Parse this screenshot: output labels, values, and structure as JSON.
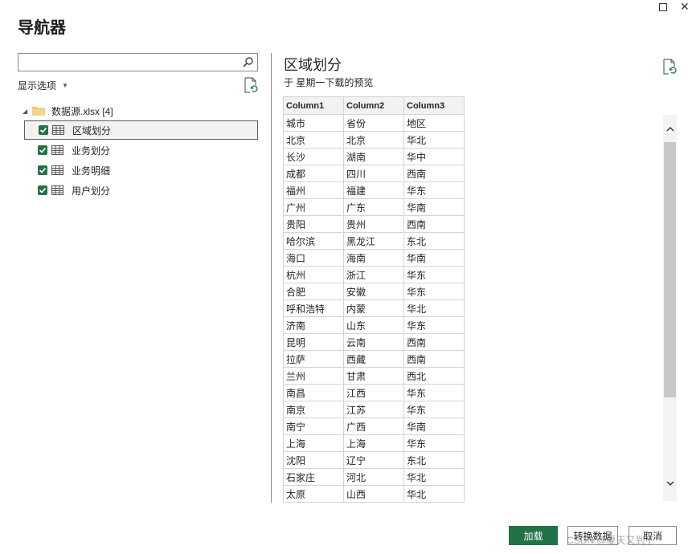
{
  "window": {
    "title": "导航器"
  },
  "navigator": {
    "search": {
      "value": "",
      "placeholder": ""
    },
    "display_options_label": "显示选项",
    "tree": {
      "root_label": "数据源.xlsx [4]",
      "items": [
        {
          "label": "区域划分",
          "checked": true,
          "selected": true
        },
        {
          "label": "业务划分",
          "checked": true,
          "selected": false
        },
        {
          "label": "业务明细",
          "checked": true,
          "selected": false
        },
        {
          "label": "用户划分",
          "checked": true,
          "selected": false
        }
      ]
    }
  },
  "preview": {
    "title": "区域划分",
    "subtitle": "于 星期一下载的预览",
    "columns": [
      "Column1",
      "Column2",
      "Column3"
    ],
    "rows": [
      [
        "城市",
        "省份",
        "地区"
      ],
      [
        "北京",
        "北京",
        "华北"
      ],
      [
        "长沙",
        "湖南",
        "华中"
      ],
      [
        "成都",
        "四川",
        "西南"
      ],
      [
        "福州",
        "福建",
        "华东"
      ],
      [
        "广州",
        "广东",
        "华南"
      ],
      [
        "贵阳",
        "贵州",
        "西南"
      ],
      [
        "哈尔滨",
        "黑龙江",
        "东北"
      ],
      [
        "海口",
        "海南",
        "华南"
      ],
      [
        "杭州",
        "浙江",
        "华东"
      ],
      [
        "合肥",
        "安徽",
        "华东"
      ],
      [
        "呼和浩特",
        "内蒙",
        "华北"
      ],
      [
        "济南",
        "山东",
        "华东"
      ],
      [
        "昆明",
        "云南",
        "西南"
      ],
      [
        "拉萨",
        "西藏",
        "西南"
      ],
      [
        "兰州",
        "甘肃",
        "西北"
      ],
      [
        "南昌",
        "江西",
        "华东"
      ],
      [
        "南京",
        "江苏",
        "华东"
      ],
      [
        "南宁",
        "广西",
        "华南"
      ],
      [
        "上海",
        "上海",
        "华东"
      ],
      [
        "沈阳",
        "辽宁",
        "东北"
      ],
      [
        "石家庄",
        "河北",
        "华北"
      ],
      [
        "太原",
        "山西",
        "华北"
      ]
    ]
  },
  "footer": {
    "load_label": "加载",
    "transform_label": "转换数据",
    "cancel_label": "取消"
  },
  "watermark": "CSDN @夏天又到了",
  "colors": {
    "accent": "#217346",
    "divider": "#8a8886",
    "table_border": "#d4d4d4"
  },
  "icons": {
    "search": "search-icon",
    "refresh": "refresh-file-icon",
    "folder": "folder-icon",
    "table": "table-icon",
    "checkbox": "checkbox-checked-icon"
  }
}
